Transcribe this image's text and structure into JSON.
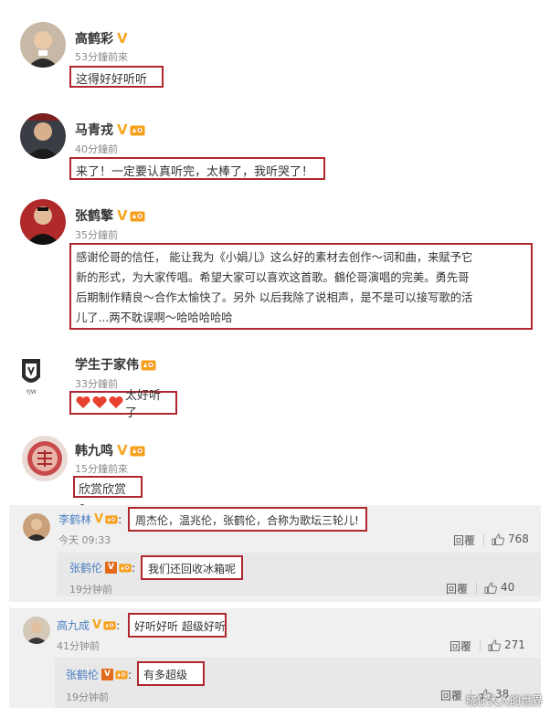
{
  "posts": [
    {
      "name": "高鹤彩",
      "time": "53分鐘前來",
      "text": "这得好好听听"
    },
    {
      "name": "马青戎",
      "time": "40分鐘前",
      "text": "来了！一定要认真听完，太棒了，我听哭了！"
    },
    {
      "name": "张鹤擎",
      "time": "35分鐘前",
      "lines": [
        "感谢伦哥的信任， 能让我为《小娟儿》这么好的素材去创作～词和曲，来赋予它",
        "新的形式，为大家传唱。希望大家可以喜欢这首歌。鶴伦哥演唱的完美。勇先哥",
        "后期制作精良～合作太愉快了。另外 以后我除了说相声，是不是可以接写歌的活",
        "儿了...两不耽误啊～哈哈哈哈哈"
      ]
    },
    {
      "name": "学生于家伟",
      "time": "33分鐘前",
      "text": "太好听了",
      "avatar_text": "YJW"
    },
    {
      "name": "韩九鸣",
      "time": "15分鐘前來",
      "text": "欣赏欣赏～"
    }
  ],
  "threads": [
    {
      "user": "李鹤林",
      "colon": ":",
      "comment": "周杰伦，温兆伦，张鹤伦，合称为歌坛三轮儿!",
      "time": "今天 09:33",
      "reply_label": "回覆",
      "likes": "768",
      "reply": {
        "user": "张鹤伦",
        "colon": ":",
        "comment": "我们还回收冰箱呢",
        "time": "19分钟前",
        "reply_label": "回覆",
        "likes": "40"
      }
    },
    {
      "user": "高九成",
      "colon": ":",
      "comment": "好听好听 超级好听",
      "time": "41分钟前",
      "reply_label": "回覆",
      "likes": "271",
      "reply": {
        "user": "张鹤伦",
        "colon": ":",
        "comment": "有多超级",
        "time": "19分钟前",
        "reply_label": "回覆",
        "likes": "38"
      }
    }
  ],
  "badges": {
    "verified": "V",
    "vip_square": "V"
  },
  "watermark": "晓仔大人的世界",
  "icons": [
    "verified-v-icon",
    "level-badge-icon",
    "thumbs-up-icon",
    "heart-icon"
  ],
  "colors": {
    "highlight_border": "#b0272e",
    "link_blue": "#4a7fc1",
    "verified_gold": "#f5a623",
    "panel_bg": "#f0f0f0"
  }
}
